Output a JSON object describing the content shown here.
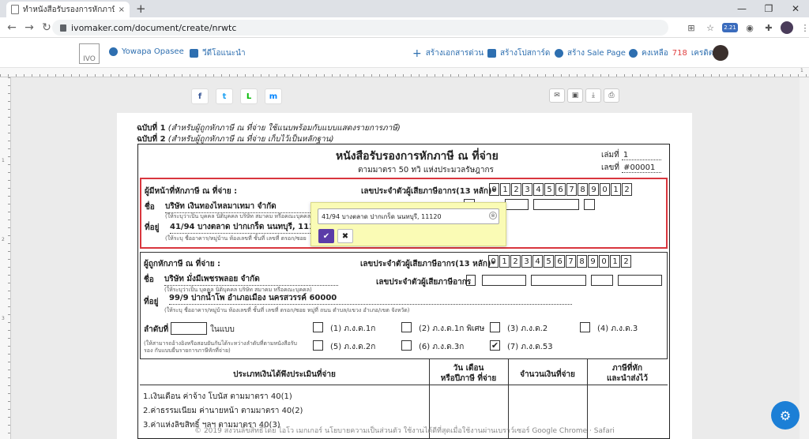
{
  "browser": {
    "tab_title": "ทำหนังสือรับรองการหักภาษี ณ ที่จ่าย | ",
    "tab_close": "×",
    "new_tab": "+",
    "url": "ivomaker.com/document/create/nrwtc",
    "ext_badge": "2.21",
    "win_min": "—",
    "win_max": "❐",
    "win_close": "✕"
  },
  "app_header": {
    "logo": "IVO",
    "user_name": "Yowapa Opasee",
    "video_link": "วีดีโอแนะนำ",
    "create_doc": "สร้างเอกสารด่วน",
    "create_poster": "สร้างโปสการ์ด",
    "create_salepage": "สร้าง Sale Page",
    "credit_prefix": "คงเหลือ",
    "credit_value": "718",
    "credit_suffix": "เครดิต"
  },
  "ruler": {
    "labels_top": [
      "1"
    ],
    "labels_left": [
      "1",
      "2",
      "3"
    ]
  },
  "share": {
    "facebook": "f",
    "twitter": "t",
    "line": "L",
    "messenger": "m"
  },
  "doc": {
    "copy1_label": "ฉบับที่ 1",
    "copy1_note": "(สำหรับผู้ถูกหักภาษี ณ ที่จ่าย ใช้แนบพร้อมกับแบบแสดงรายการภาษี)",
    "copy2_label": "ฉบับที่ 2",
    "copy2_note": "(สำหรับผู้ถูกหักภาษี ณ ที่จ่าย เก็บไว้เป็นหลักฐาน)",
    "title": "หนังสือรับรองการหักภาษี ณ ที่จ่าย",
    "subtitle": "ตามมาตรา 50 ทวิ แห่งประมวลรัษฎากร",
    "book_label": "เล่มที่",
    "book_value": "1",
    "number_label": "เลขที่",
    "number_value": "#00001",
    "payer": {
      "heading": "ผู้มีหน้าที่หักภาษี ณ ที่จ่าย :",
      "tax_id_label": "เลขประจำตัวผู้เสียภาษีอากร(13 หลัก)*",
      "tax_id_digits": [
        "0",
        "1",
        "2",
        "3",
        "4",
        "5",
        "6",
        "7",
        "8",
        "9",
        "0",
        "1",
        "2"
      ],
      "name_label": "ชื่อ",
      "name_value": "บริษัท เงินทองไหลมาเทมา จำกัด",
      "name_hint": "(ให้ระบุว่าเป็น บุคคล นิติบุคคล บริษัท สมาคม หรือคณะบุคคล)",
      "addr_label": "ที่อยู่",
      "addr_value": "41/94 บางตลาด ปากเกร็ด นนทบุรี, 11120",
      "addr_hint": "(ให้ระบุ ชื่ออาคาร/หมู่บ้าน ห้องเลขที่ ชั้นที่ เลขที่ ตรอก/ซอย"
    },
    "payee": {
      "heading": "ผู้ถูกหักภาษี ณ ที่จ่าย :",
      "tax_id_label": "เลขประจำตัวผู้เสียภาษีอากร(13 หลัก)*",
      "tax_id_digits": [
        "0",
        "1",
        "2",
        "3",
        "4",
        "5",
        "6",
        "7",
        "8",
        "9",
        "0",
        "1",
        "2"
      ],
      "name_label": "ชื่อ",
      "name_value": "บริษัท มั่งมีเพชรพลอย จำกัด",
      "name_hint": "(ให้ระบุว่าเป็น บุคคล นิติบุคคล บริษัท สมาคม หรือคณะบุคคล)",
      "taxid2_label": "เลขประจำตัวผู้เสียภาษีอากร",
      "addr_label": "ที่อยู่",
      "addr_value": "99/9 ปากน้ำโพ อำเภอเมือง นครสวรรค์ 60000",
      "addr_hint": "(ให้ระบุ ชื่ออาคาร/หมู่บ้าน ห้องเลขที่ ชั้นที่ เลขที่ ตรอก/ซอย หมู่ที่ ถนน ตำบล/แขวง อำเภอ/เขต จังหวัด)",
      "order_label": "ลำดับที่",
      "order_suffix": "ในแบบ",
      "order_hint1": "(ให้สามารถอ้างอิงหรือสอบยันกันได้ระหว่างลำดับที่ตามหนังสือรับ",
      "order_hint2": "รอง กับแบบยื่นรายการภาษีหักที่จ่าย)",
      "forms": [
        {
          "label": "(1) ภ.ง.ด.1ก",
          "checked": false
        },
        {
          "label": "(2) ภ.ง.ด.1ก พิเศษ",
          "checked": false
        },
        {
          "label": "(3) ภ.ง.ด.2",
          "checked": false
        },
        {
          "label": "(4) ภ.ง.ด.3",
          "checked": false
        },
        {
          "label": "(5) ภ.ง.ด.2ก",
          "checked": false
        },
        {
          "label": "(6) ภ.ง.ด.3ก",
          "checked": false
        },
        {
          "label": "(7) ภ.ง.ด.53",
          "checked": true
        }
      ],
      "check_mark": "✔"
    },
    "table": {
      "col1": "ประเภทเงินได้พึงประเมินที่จ่าย",
      "col2_line1": "วัน เดือน",
      "col2_line2": "หรือปีภาษี ที่จ่าย",
      "col3": "จำนวนเงินที่จ่าย",
      "col4_line1": "ภาษีที่หัก",
      "col4_line2": "และนำส่งไว้",
      "rows": [
        "1.เงินเดือน ค่าจ้าง โบนัส ตามมาตรา 40(1)",
        "2.ค่าธรรมเนียม ค่านายหน้า ตามมาตรา 40(2)",
        "3.ค่าแห่งลิขสิทธิ์ ฯลฯ ตามมาตรา 40(3)"
      ]
    }
  },
  "popup": {
    "input_value": "41/94 บางตลาด ปากเกร็ด นนทบุรี, 11120",
    "clear": "⊗",
    "confirm": "✔",
    "cancel": "✖"
  },
  "footer": "© 2019 สงวนลิขสิทธิ์โดย ไอโว เมกเกอร์ นโยบายความเป็นส่วนตัว ใช้งานได้ดีที่สุดเมื่อใช้งานผ่านเบราว์เซอร์ Google Chrome · Safari",
  "fab_icon": "⚙"
}
